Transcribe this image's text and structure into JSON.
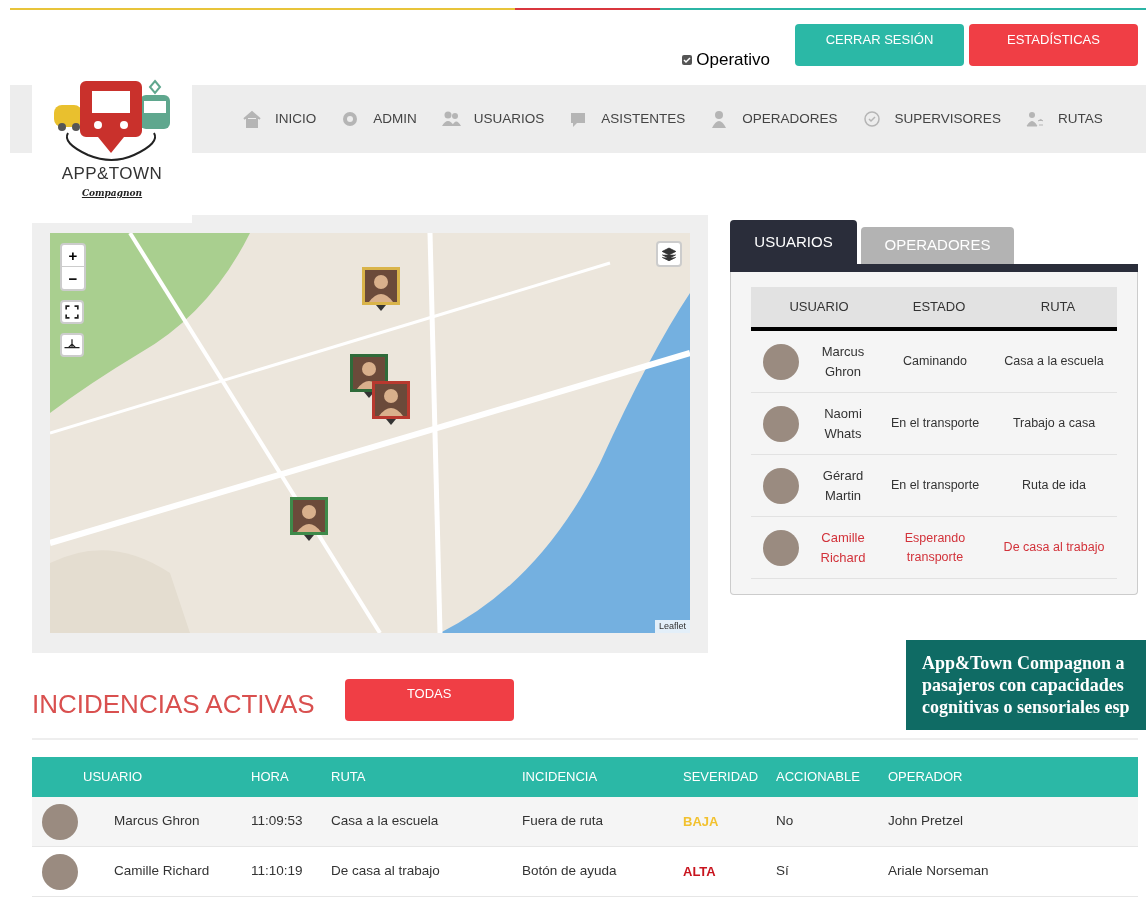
{
  "header": {
    "operativo": {
      "label": "Operativo",
      "checked": true
    },
    "buttons": [
      {
        "label": "CERRAR SESIÓN",
        "kind": "teal"
      },
      {
        "label": "ESTADÍSTICAS",
        "kind": "red"
      }
    ]
  },
  "logo": {
    "name": "APP&TOWN",
    "tagline": "Compagnon"
  },
  "nav": [
    {
      "label": "INICIO"
    },
    {
      "label": "ADMIN"
    },
    {
      "label": "USUARIOS"
    },
    {
      "label": "ASISTENTES"
    },
    {
      "label": "OPERADORES"
    },
    {
      "label": "SUPERVISORES"
    },
    {
      "label": "RUTAS"
    }
  ],
  "map": {
    "zoom_in": "+",
    "zoom_out": "−",
    "attribution": "Leaflet",
    "markers": [
      {
        "color": "#d9b44a"
      },
      {
        "color": "#2f6b3a"
      },
      {
        "color": "#b8392f"
      },
      {
        "color": "#3e8a4a"
      }
    ]
  },
  "tabs": [
    {
      "label": "USUARIOS",
      "selected": true
    },
    {
      "label": "OPERADORES",
      "selected": false
    }
  ],
  "users_table": {
    "columns": [
      "USUARIO",
      "ESTADO",
      "RUTA"
    ],
    "rows": [
      {
        "name": "Marcus Ghron",
        "estado": "Caminando",
        "ruta": "Casa a la escuela",
        "alert": false
      },
      {
        "name": "Naomi Whats",
        "estado": "En el transporte",
        "ruta": "Trabajo a casa",
        "alert": false
      },
      {
        "name": "Gérard Martin",
        "estado": "En el transporte",
        "ruta": "Ruta de ida",
        "alert": false
      },
      {
        "name": "Camille Richard",
        "estado": "Esperando transporte",
        "ruta": "De casa al trabajo",
        "alert": true
      }
    ]
  },
  "banner": {
    "lines": [
      "App&Town Compagnon a",
      "pasajeros con capacidades",
      "cognitivas o sensoriales esp"
    ]
  },
  "incidents": {
    "title": "INCIDENCIAS ACTIVAS",
    "button": "TODAS",
    "columns": [
      "USUARIO",
      "HORA",
      "RUTA",
      "INCIDENCIA",
      "SEVERIDAD",
      "ACCIONABLE",
      "OPERADOR"
    ],
    "rows": [
      {
        "usuario": "Marcus Ghron",
        "hora": "11:09:53",
        "ruta": "Casa a la escuela",
        "incidencia": "Fuera de ruta",
        "severidad": "BAJA",
        "color": "#f2c12e",
        "accionable": "No",
        "operador": "John Pretzel"
      },
      {
        "usuario": "Camille Richard",
        "hora": "11:10:19",
        "ruta": "De casa al trabajo",
        "incidencia": "Botón de ayuda",
        "severidad": "ALTA",
        "color": "#c8141e",
        "accionable": "Sí",
        "operador": "Ariale Norseman"
      }
    ]
  }
}
